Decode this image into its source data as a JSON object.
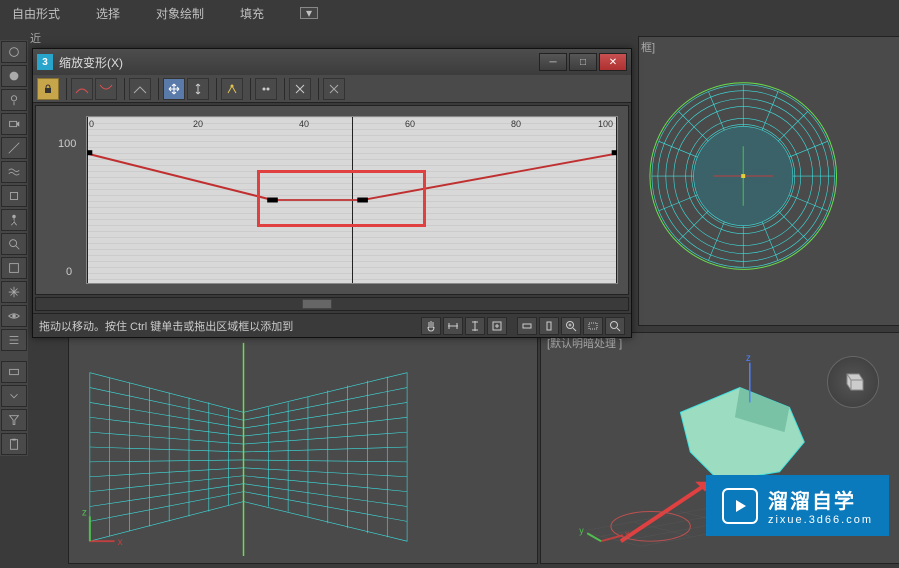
{
  "menu": {
    "freeform": "自由形式",
    "select": "选择",
    "objpaint": "对象绘制",
    "fill": "填充"
  },
  "viewport": {
    "top_left_partial": "近",
    "top_right_bracket": "框]",
    "br_label": "[默认明暗处理 ]"
  },
  "dialog": {
    "title": "缩放变形(X)",
    "status_hint": "拖动以移动。按住 Ctrl 键单击或拖出区域框以添加到",
    "y100": "100",
    "y0": "0",
    "x0": "0",
    "x20": "20",
    "x40": "40",
    "x60": "60",
    "x80": "80",
    "x100": "100"
  },
  "logo": {
    "title": "溜溜自学",
    "url": "zixue.3d66.com"
  },
  "chart_data": {
    "type": "line",
    "title": "缩放变形(X)",
    "xlabel": "",
    "ylabel": "",
    "xlim": [
      0,
      100
    ],
    "ylim": [
      -20,
      120
    ],
    "x": [
      0,
      35,
      52,
      100
    ],
    "y": [
      100,
      55,
      55,
      100
    ]
  }
}
